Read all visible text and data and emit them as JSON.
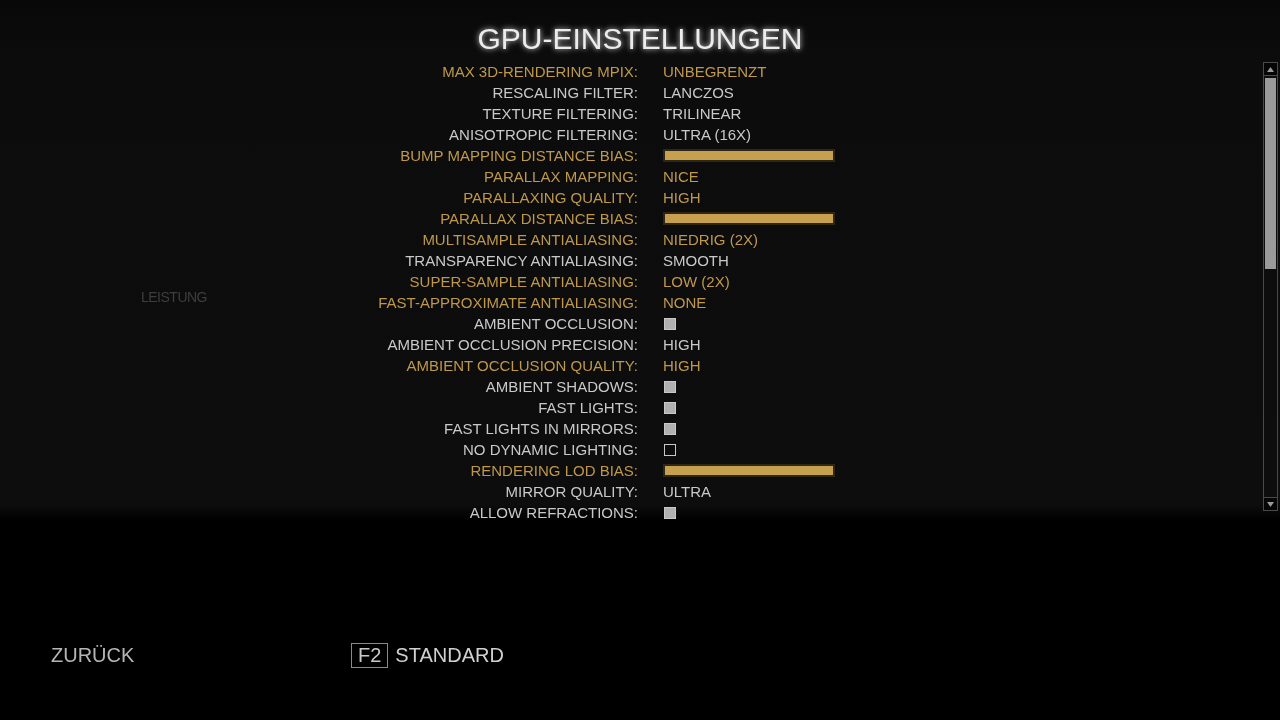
{
  "title": "GPU-EINSTELLUNGEN",
  "background_heading": "LEISTUNG",
  "settings": [
    {
      "label": "MAX 3D-RENDERING MPIX:",
      "kind": "choice",
      "value": "UNBEGRENZT",
      "highlighted": true
    },
    {
      "label": "RESCALING FILTER:",
      "kind": "choice",
      "value": "LANCZOS",
      "highlighted": false
    },
    {
      "label": "TEXTURE FILTERING:",
      "kind": "choice",
      "value": "TRILINEAR",
      "highlighted": false
    },
    {
      "label": "ANISOTROPIC FILTERING:",
      "kind": "choice",
      "value": "ULTRA (16X)",
      "highlighted": false
    },
    {
      "label": "BUMP MAPPING DISTANCE BIAS:",
      "kind": "slider",
      "level": 1,
      "highlighted": true
    },
    {
      "label": "PARALLAX MAPPING:",
      "kind": "choice",
      "value": "NICE",
      "highlighted": true
    },
    {
      "label": "PARALLAXING QUALITY:",
      "kind": "choice",
      "value": "HIGH",
      "highlighted": true
    },
    {
      "label": "PARALLAX DISTANCE BIAS:",
      "kind": "slider",
      "level": 1,
      "highlighted": true
    },
    {
      "label": "MULTISAMPLE ANTIALIASING:",
      "kind": "choice",
      "value": "NIEDRIG (2X)",
      "highlighted": true
    },
    {
      "label": "TRANSPARENCY ANTIALIASING:",
      "kind": "choice",
      "value": "SMOOTH",
      "highlighted": false
    },
    {
      "label": "SUPER-SAMPLE ANTIALIASING:",
      "kind": "choice",
      "value": "LOW (2X)",
      "highlighted": true
    },
    {
      "label": "FAST-APPROXIMATE ANTIALIASING:",
      "kind": "choice",
      "value": "NONE",
      "highlighted": true
    },
    {
      "label": "AMBIENT OCCLUSION:",
      "kind": "checkbox",
      "checked": true,
      "highlighted": false
    },
    {
      "label": "AMBIENT OCCLUSION PRECISION:",
      "kind": "choice",
      "value": "HIGH",
      "highlighted": false
    },
    {
      "label": "AMBIENT OCCLUSION QUALITY:",
      "kind": "choice",
      "value": "HIGH",
      "highlighted": true
    },
    {
      "label": "AMBIENT SHADOWS:",
      "kind": "checkbox",
      "checked": true,
      "highlighted": false
    },
    {
      "label": "FAST LIGHTS:",
      "kind": "checkbox",
      "checked": true,
      "highlighted": false
    },
    {
      "label": "FAST LIGHTS IN MIRRORS:",
      "kind": "checkbox",
      "checked": true,
      "highlighted": false
    },
    {
      "label": "NO DYNAMIC LIGHTING:",
      "kind": "checkbox",
      "checked": false,
      "highlighted": false
    },
    {
      "label": "RENDERING LOD BIAS:",
      "kind": "slider",
      "level": 1,
      "highlighted": true
    },
    {
      "label": "MIRROR QUALITY:",
      "kind": "choice",
      "value": "ULTRA",
      "highlighted": false
    },
    {
      "label": "ALLOW REFRACTIONS:",
      "kind": "checkbox",
      "checked": true,
      "highlighted": false
    }
  ],
  "footer": {
    "back": "ZURÜCK",
    "default_key": "F2",
    "default_label": "STANDARD"
  }
}
